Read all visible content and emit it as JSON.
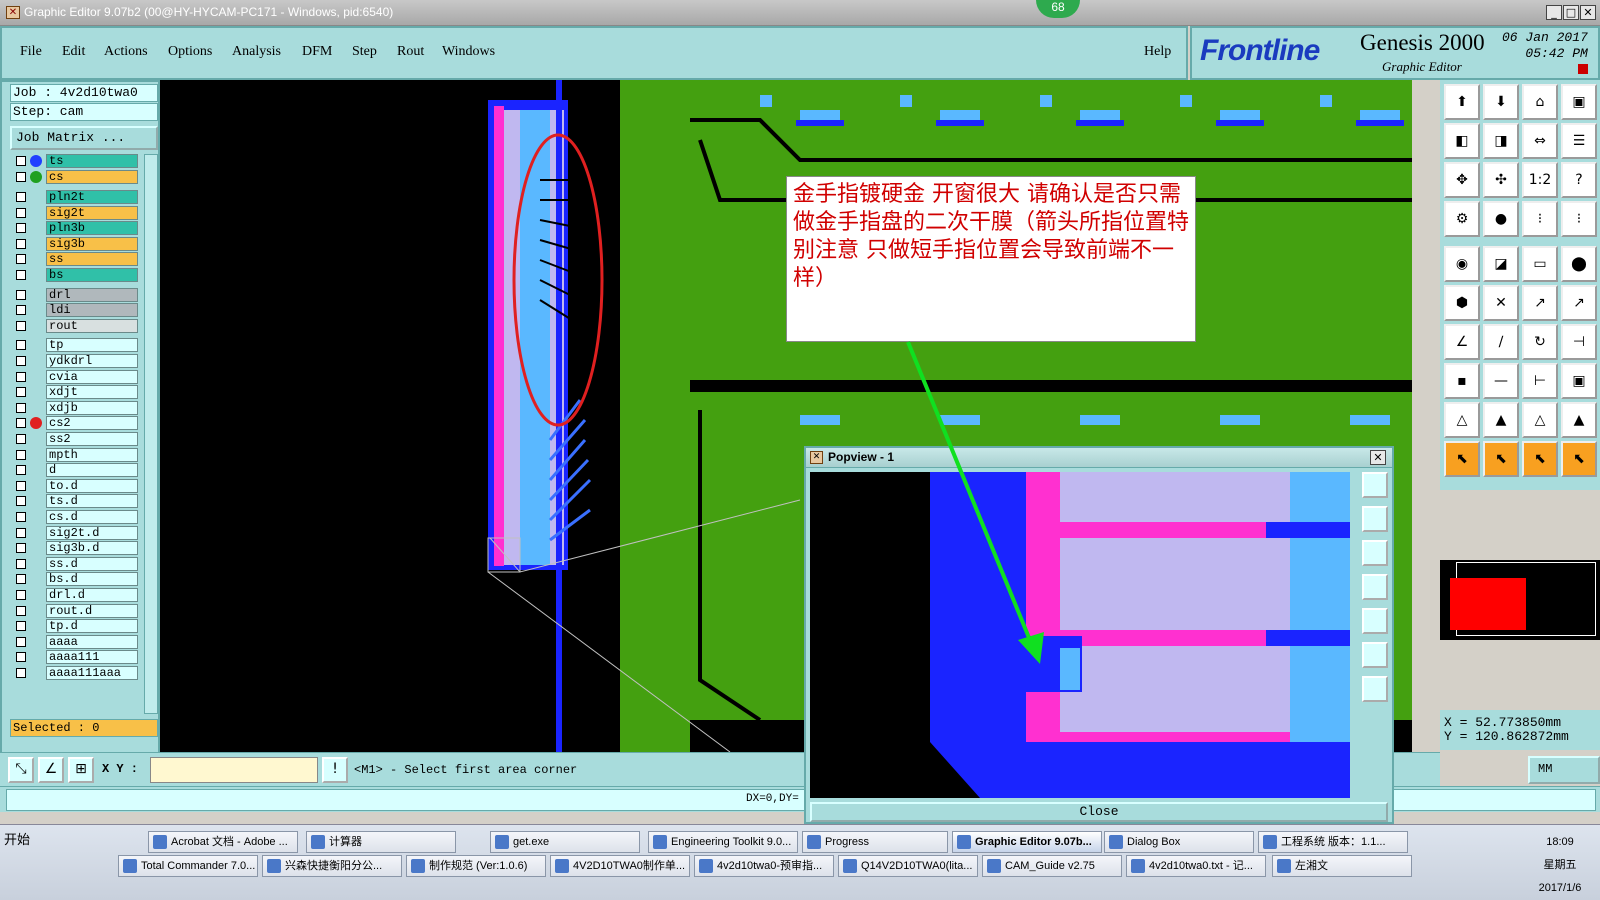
{
  "window": {
    "title": "Graphic Editor 9.07b2 (00@HY-HYCAM-PC171 - Windows, pid:6540)",
    "badge": "68"
  },
  "menu": [
    "File",
    "Edit",
    "Actions",
    "Options",
    "Analysis",
    "DFM",
    "Step",
    "Rout",
    "Windows"
  ],
  "help": "Help",
  "brand": {
    "logo": "Frontline",
    "product": "Genesis 2000",
    "subtitle": "Graphic Editor",
    "date": "06 Jan 2017",
    "time": "05:42 PM"
  },
  "job": {
    "job_line": "Job : 4v2d10twa0",
    "step_line": "Step: cam",
    "matrix_button": "Job Matrix ..."
  },
  "layers": [
    {
      "name": "ts",
      "color": "#30c0a8",
      "dot": "#2040ff"
    },
    {
      "name": "cs",
      "color": "#f8c048",
      "dot": "#20a020"
    },
    {
      "name": "pln2t",
      "color": "#30c0a8",
      "dot": ""
    },
    {
      "name": "sig2t",
      "color": "#f8c048",
      "dot": ""
    },
    {
      "name": "pln3b",
      "color": "#30c0a8",
      "dot": ""
    },
    {
      "name": "sig3b",
      "color": "#f8c048",
      "dot": ""
    },
    {
      "name": "ss",
      "color": "#f8c048",
      "dot": ""
    },
    {
      "name": "bs",
      "color": "#30c0a8",
      "dot": ""
    },
    {
      "name": "drl",
      "color": "#b0b8bc",
      "dot": ""
    },
    {
      "name": "ldi",
      "color": "#b0b8bc",
      "dot": ""
    },
    {
      "name": "rout",
      "color": "#d8e0e0",
      "dot": ""
    },
    {
      "name": "tp",
      "color": "#d8ffff",
      "dot": ""
    },
    {
      "name": "ydkdrl",
      "color": "#d8ffff",
      "dot": ""
    },
    {
      "name": "cvia",
      "color": "#d8ffff",
      "dot": ""
    },
    {
      "name": "xdjt",
      "color": "#d8ffff",
      "dot": ""
    },
    {
      "name": "xdjb",
      "color": "#d8ffff",
      "dot": ""
    },
    {
      "name": "cs2",
      "color": "#d8ffff",
      "dot": "#e02020"
    },
    {
      "name": "ss2",
      "color": "#d8ffff",
      "dot": ""
    },
    {
      "name": "mpth",
      "color": "#d8ffff",
      "dot": ""
    },
    {
      "name": "d",
      "color": "#d8ffff",
      "dot": ""
    },
    {
      "name": "to.d",
      "color": "#d8ffff",
      "dot": ""
    },
    {
      "name": "ts.d",
      "color": "#d8ffff",
      "dot": ""
    },
    {
      "name": "cs.d",
      "color": "#d8ffff",
      "dot": ""
    },
    {
      "name": "sig2t.d",
      "color": "#d8ffff",
      "dot": ""
    },
    {
      "name": "sig3b.d",
      "color": "#d8ffff",
      "dot": ""
    },
    {
      "name": "ss.d",
      "color": "#d8ffff",
      "dot": ""
    },
    {
      "name": "bs.d",
      "color": "#d8ffff",
      "dot": ""
    },
    {
      "name": "drl.d",
      "color": "#d8ffff",
      "dot": ""
    },
    {
      "name": "rout.d",
      "color": "#d8ffff",
      "dot": ""
    },
    {
      "name": "tp.d",
      "color": "#d8ffff",
      "dot": ""
    },
    {
      "name": "aaaa",
      "color": "#d8ffff",
      "dot": ""
    },
    {
      "name": "aaaa111",
      "color": "#d8ffff",
      "dot": ""
    },
    {
      "name": "aaaa111aaa",
      "color": "#d8ffff",
      "dot": ""
    }
  ],
  "selected": "Selected : 0",
  "annotation": "金手指镀硬金   开窗很大   请确认是否只需做金手指盘的二次干膜（箭头所指位置特别注意   只做短手指位置会导致前端不一样）",
  "coords": {
    "x": "X  =   52.773850mm",
    "y": "Y  =  120.862872mm"
  },
  "units": "MM",
  "command": {
    "xy_label": "X Y :",
    "prompt": "<M1> - Select first area corner",
    "dxdy": "DX=0,DY="
  },
  "popview": {
    "title": "Popview - 1",
    "close": "Close"
  },
  "taskbar": {
    "start": "开始",
    "row1": [
      "Acrobat 文档 - Adobe ...",
      "计算器",
      "get.exe",
      "Engineering Toolkit 9.0...",
      "Progress",
      "Graphic Editor 9.07b...",
      "Dialog Box",
      "工程系统   版本：1.1..."
    ],
    "row2": [
      "Total Commander 7.0...",
      "兴森快捷衡阳分公...",
      "制作规范 (Ver:1.0.6)",
      "4V2D10TWA0制作单...",
      "4v2d10twa0-预审指...",
      "Q14V2D10TWA0(lita...",
      "CAM_Guide v2.75",
      "4v2d10twa0.txt - 记...",
      "左湘文"
    ],
    "time": "18:09",
    "weekday": "星期五",
    "date": "2017/1/6"
  }
}
